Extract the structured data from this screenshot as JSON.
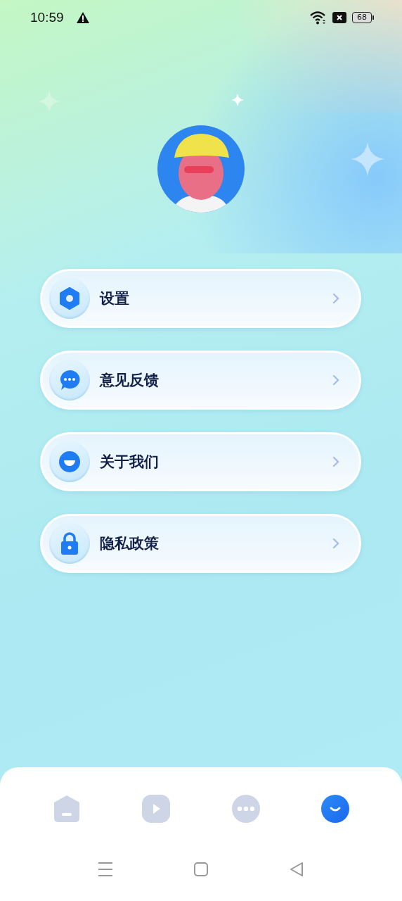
{
  "status_bar": {
    "time": "10:59",
    "battery": "68"
  },
  "menu": [
    {
      "label": "设置",
      "kind": "gear"
    },
    {
      "label": "意见反馈",
      "kind": "chat"
    },
    {
      "label": "关于我们",
      "kind": "smile"
    },
    {
      "label": "隐私政策",
      "kind": "lock"
    }
  ],
  "tabs": [
    {
      "kind": "home",
      "selected": false
    },
    {
      "kind": "play",
      "selected": false
    },
    {
      "kind": "more",
      "selected": false
    },
    {
      "kind": "profile",
      "selected": true
    }
  ]
}
